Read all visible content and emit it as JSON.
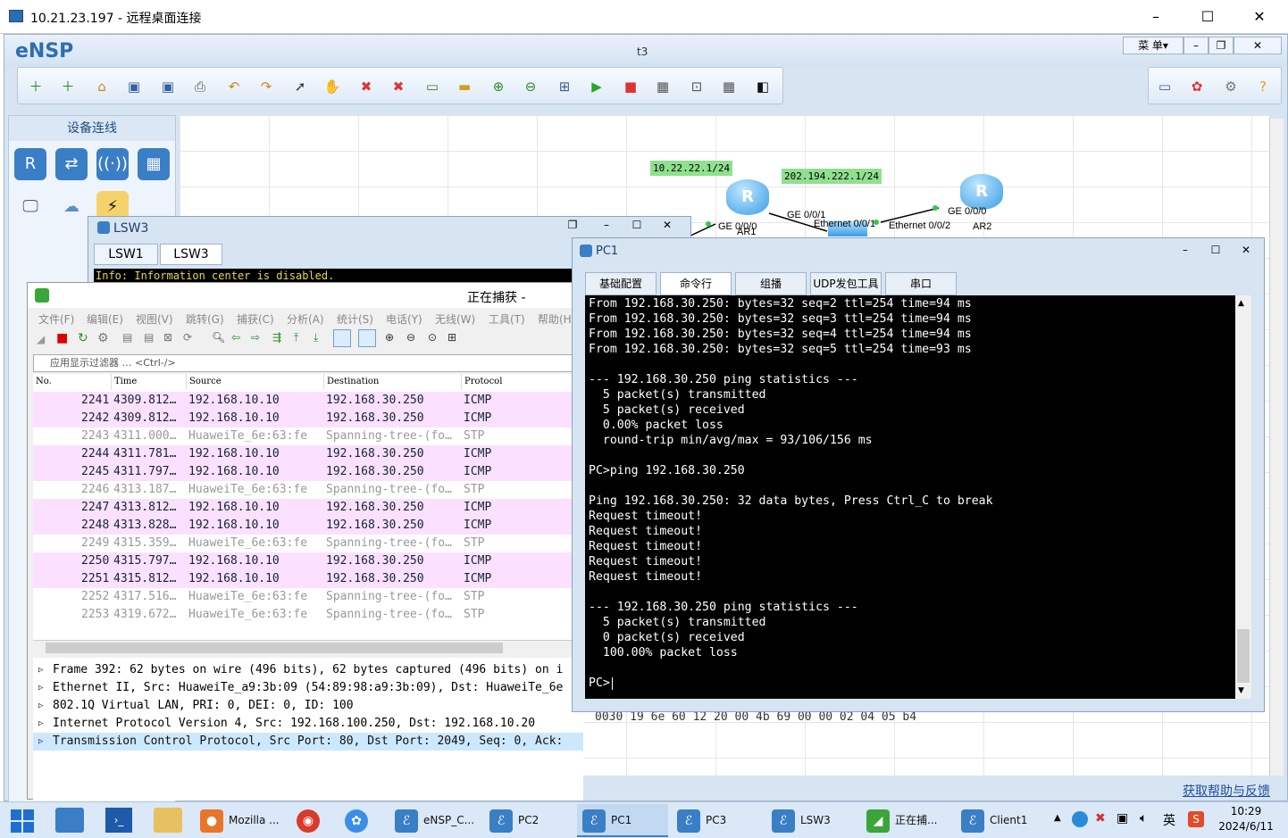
{
  "rdp": {
    "title": "10.21.23.197 - 远程桌面连接"
  },
  "ensp": {
    "app_name": "eNSP",
    "doc_name": "t3",
    "menu_label": "菜 单▾",
    "device_panel_title": "设备连线"
  },
  "topology": {
    "net_label_1": "10.22.22.1/24",
    "net_label_2": "202.194.222.1/24",
    "ar1_port": "GE 0/0/0",
    "ar1_name": "AR1",
    "ar1_port2": "GE 0/0/1",
    "sw_port_a": "Ethernet 0/0/1",
    "sw_port_b": "Ethernet 0/0/2",
    "ar2_port": "GE 0/0/0",
    "ar2_name": "AR2"
  },
  "lsw3": {
    "title": "LSW3",
    "tabs": [
      "LSW1",
      "LSW3"
    ],
    "info_line": "Info: Information center is disabled."
  },
  "wireshark": {
    "title": "正在捕获 -",
    "menu": [
      "文件(F)",
      "编辑(E)",
      "视图(V)",
      "跳转(G)",
      "捕获(C)",
      "分析(A)",
      "统计(S)",
      "电话(Y)",
      "无线(W)",
      "工具(T)",
      "帮助(H)"
    ],
    "filter_placeholder": "应用显示过滤器 … <Ctrl-/>",
    "columns": [
      "No.",
      "Time",
      "Source",
      "Destination",
      "Protocol"
    ],
    "packets": [
      {
        "no": "2241",
        "time": "4309.812…",
        "src": "192.168.10.10",
        "dst": "192.168.30.250",
        "proto": "ICMP"
      },
      {
        "no": "2242",
        "time": "4309.812…",
        "src": "192.168.10.10",
        "dst": "192.168.30.250",
        "proto": "ICMP"
      },
      {
        "no": "2243",
        "time": "4311.000…",
        "src": "HuaweiTe_6e:63:fe",
        "dst": "Spanning-tree-(fo…",
        "proto": "STP"
      },
      {
        "no": "2244",
        "time": "4311.781…",
        "src": "192.168.10.10",
        "dst": "192.168.30.250",
        "proto": "ICMP"
      },
      {
        "no": "2245",
        "time": "4311.797…",
        "src": "192.168.10.10",
        "dst": "192.168.30.250",
        "proto": "ICMP"
      },
      {
        "no": "2246",
        "time": "4313.187…",
        "src": "HuaweiTe_6e:63:fe",
        "dst": "Spanning-tree-(fo…",
        "proto": "STP"
      },
      {
        "no": "2247",
        "time": "4313.812…",
        "src": "192.168.10.10",
        "dst": "192.168.30.250",
        "proto": "ICMP"
      },
      {
        "no": "2248",
        "time": "4313.828…",
        "src": "192.168.10.10",
        "dst": "192.168.30.250",
        "proto": "ICMP"
      },
      {
        "no": "2249",
        "time": "4315.359…",
        "src": "HuaweiTe_6e:63:fe",
        "dst": "Spanning-tree-(fo…",
        "proto": "STP"
      },
      {
        "no": "2250",
        "time": "4315.797…",
        "src": "192.168.10.10",
        "dst": "192.168.30.250",
        "proto": "ICMP"
      },
      {
        "no": "2251",
        "time": "4315.812…",
        "src": "192.168.10.10",
        "dst": "192.168.30.250",
        "proto": "ICMP"
      },
      {
        "no": "2252",
        "time": "4317.516…",
        "src": "HuaweiTe_6e:63:fe",
        "dst": "Spanning-tree-(fo…",
        "proto": "STP"
      },
      {
        "no": "2253",
        "time": "4319.672…",
        "src": "HuaweiTe_6e:63:fe",
        "dst": "Spanning-tree-(fo…",
        "proto": "STP"
      }
    ],
    "details": [
      "Frame 392: 62 bytes on wire (496 bits), 62 bytes captured (496 bits) on i",
      "Ethernet II, Src: HuaweiTe_a9:3b:09 (54:89:98:a9:3b:09), Dst: HuaweiTe_6e",
      "802.1Q Virtual LAN, PRI: 0, DEI: 0, ID: 100",
      "Internet Protocol Version 4, Src: 192.168.100.250, Dst: 192.168.10.20",
      "Transmission Control Protocol, Src Port: 80, Dst Port: 2049, Seq: 0, Ack:"
    ],
    "hex_line": "0030  19 6e 60 12 20 00 4b 69  00 00 02 04 05 b4"
  },
  "pc1": {
    "title": "PC1",
    "tabs": [
      "基础配置",
      "命令行",
      "组播",
      "UDP发包工具",
      "串口"
    ],
    "terminal": [
      "From 192.168.30.250: bytes=32 seq=2 ttl=254 time=94 ms",
      "From 192.168.30.250: bytes=32 seq=3 ttl=254 time=94 ms",
      "From 192.168.30.250: bytes=32 seq=4 ttl=254 time=94 ms",
      "From 192.168.30.250: bytes=32 seq=5 ttl=254 time=93 ms",
      "",
      "--- 192.168.30.250 ping statistics ---",
      "  5 packet(s) transmitted",
      "  5 packet(s) received",
      "  0.00% packet loss",
      "  round-trip min/avg/max = 93/106/156 ms",
      "",
      "PC>ping 192.168.30.250",
      "",
      "Ping 192.168.30.250: 32 data bytes, Press Ctrl_C to break",
      "Request timeout!",
      "Request timeout!",
      "Request timeout!",
      "Request timeout!",
      "Request timeout!",
      "",
      "--- 192.168.30.250 ping statistics ---",
      "  5 packet(s) transmitted",
      "  0 packet(s) received",
      "  100.00% packet loss",
      "",
      "PC>"
    ]
  },
  "help_link": "获取帮助与反馈",
  "taskbar": {
    "items": [
      "Mozilla ...",
      "eNSP_C...",
      "PC2",
      "PC1",
      "PC3",
      "LSW3",
      "正在捕...",
      "Client1"
    ],
    "ime": "英",
    "time": "10:29",
    "date": "2024/6/11"
  },
  "colors": {
    "icmp_row": "#fce0ff",
    "net_label": "#8fe08f",
    "selected_row": "#cce8ff"
  }
}
